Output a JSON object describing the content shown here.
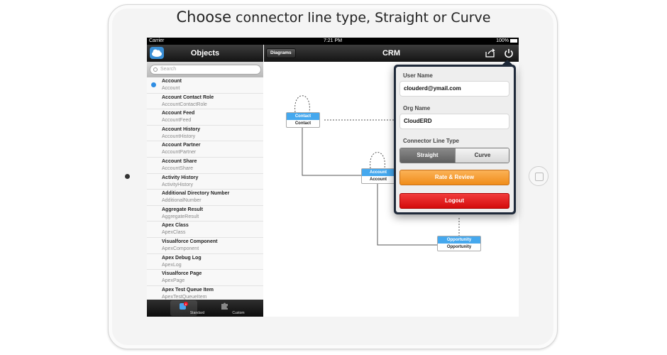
{
  "headline": {
    "bold": "Choose",
    "rest": " connector line type, Straight or Curve"
  },
  "statusbar": {
    "carrier": "Carrier",
    "time": "7:21 PM",
    "battery": "100%"
  },
  "left_panel": {
    "title": "Objects",
    "search_placeholder": "Search",
    "items": [
      {
        "label": "Account",
        "api": "Account",
        "selected": true
      },
      {
        "label": "Account Contact Role",
        "api": "AccountContactRole"
      },
      {
        "label": "Account Feed",
        "api": "AccountFeed"
      },
      {
        "label": "Account History",
        "api": "AccountHistory"
      },
      {
        "label": "Account Partner",
        "api": "AccountPartner"
      },
      {
        "label": "Account Share",
        "api": "AccountShare"
      },
      {
        "label": "Activity History",
        "api": "ActivityHistory"
      },
      {
        "label": "Additional Directory Number",
        "api": "AdditionalNumber"
      },
      {
        "label": "Aggregate Result",
        "api": "AggregateResult"
      },
      {
        "label": "Apex Class",
        "api": "ApexClass"
      },
      {
        "label": "Visualforce Component",
        "api": "ApexComponent"
      },
      {
        "label": "Apex Debug Log",
        "api": "ApexLog"
      },
      {
        "label": "Visualforce Page",
        "api": "ApexPage"
      },
      {
        "label": "Apex Test Queue Item",
        "api": "ApexTestQueueItem"
      }
    ],
    "tabs": [
      {
        "label": "Standard",
        "badge": "6",
        "selected": true
      },
      {
        "label": "Custom"
      }
    ]
  },
  "main": {
    "diagrams_button": "Diagrams",
    "title": "CRM",
    "entities": {
      "contact": {
        "header": "Contact",
        "body": "Contact"
      },
      "account": {
        "header": "Account",
        "body": "Account"
      },
      "opportunity": {
        "header": "Opportunity",
        "body": "Opportunity"
      }
    }
  },
  "popover": {
    "user_name_label": "User Name",
    "user_name_value": "clouderd@ymail.com",
    "org_name_label": "Org Name",
    "org_name_value": "CloudERD",
    "connector_label": "Connector Line Type",
    "connector_options": [
      "Straight",
      "Curve"
    ],
    "connector_selected": "Straight",
    "rate_button": "Rate & Review",
    "logout_button": "Logout"
  },
  "colors": {
    "accent_blue": "#45a8ee",
    "rate_orange": "#f59a2a",
    "logout_red": "#e51e1e"
  }
}
